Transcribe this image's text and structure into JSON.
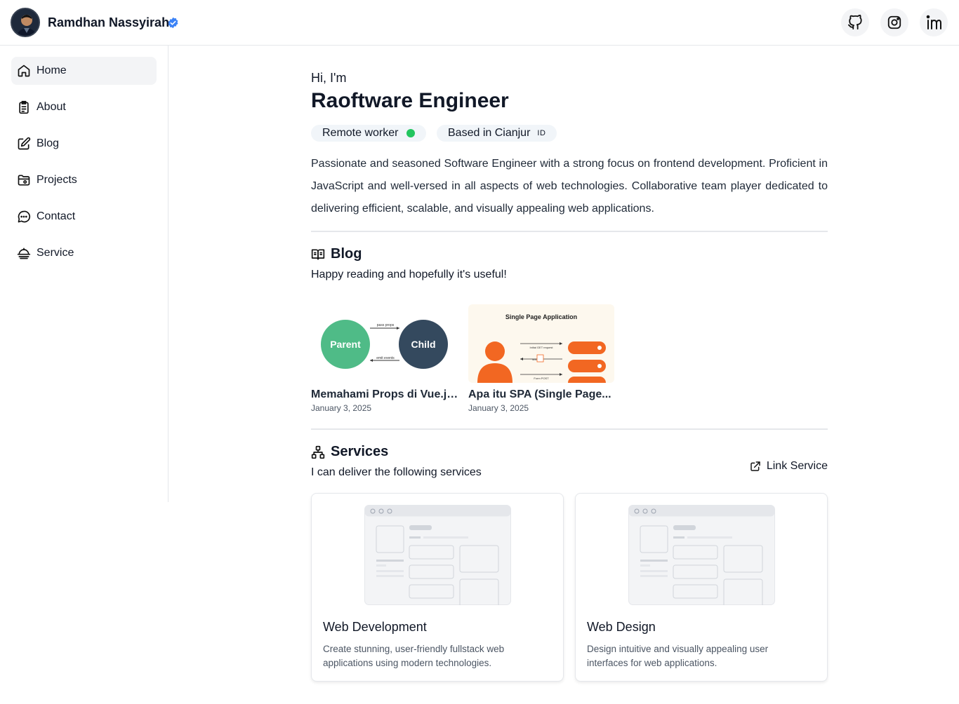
{
  "header": {
    "name": "Ramdhan Nassyirah",
    "social": [
      {
        "icon": "github-icon"
      },
      {
        "icon": "instagram-icon"
      },
      {
        "icon": "linkedin-icon"
      }
    ]
  },
  "sidebar": {
    "items": [
      {
        "label": "Home",
        "icon": "home-icon",
        "active": true
      },
      {
        "label": "About",
        "icon": "clipboard-icon"
      },
      {
        "label": "Blog",
        "icon": "edit-icon"
      },
      {
        "label": "Projects",
        "icon": "folder-icon"
      },
      {
        "label": "Contact",
        "icon": "chat-icon"
      },
      {
        "label": "Service",
        "icon": "service-icon"
      }
    ]
  },
  "hero": {
    "greeting": "Hi, I'm",
    "headline": "Raoftware Engineer",
    "chips": [
      {
        "label": "Remote worker",
        "status_color": "#22c55e"
      },
      {
        "label": "Based in Cianjur",
        "flag": "ID"
      }
    ],
    "bio": "Passionate and seasoned Software Engineer with a strong focus on frontend development. Proficient in JavaScript and well-versed in all aspects of web technologies. Collaborative team player dedicated to delivering efficient, scalable, and visually appealing web applications."
  },
  "blog": {
    "title": "Blog",
    "subtitle": "Happy reading and hopefully it's useful!",
    "posts": [
      {
        "title": "Memahami Props di Vue.js...",
        "date": "January 3, 2025",
        "thumb": {
          "parent": "Parent",
          "child": "Child",
          "top_arrow": "pass props",
          "bottom_arrow": "emit events"
        }
      },
      {
        "title": "Apa itu SPA (Single Page...",
        "date": "January 3, 2025",
        "thumb": {
          "heading": "Single Page Application",
          "label1": "Initial GET request",
          "label2": "html",
          "label3": "Form POST"
        }
      }
    ]
  },
  "services": {
    "title": "Services",
    "subtitle": "I can deliver the following services",
    "link_label": "Link Service",
    "items": [
      {
        "title": "Web Development",
        "description": "Create stunning, user-friendly fullstack web applications using modern technologies."
      },
      {
        "title": "Web Design",
        "description": "Design intuitive and visually appealing user interfaces for web applications."
      }
    ]
  },
  "colors": {
    "accent_green": "#22c55e",
    "verified_blue": "#3b82f6",
    "parent_green": "#4fbb87",
    "child_dark": "#34495e",
    "spa_orange": "#f26722"
  }
}
